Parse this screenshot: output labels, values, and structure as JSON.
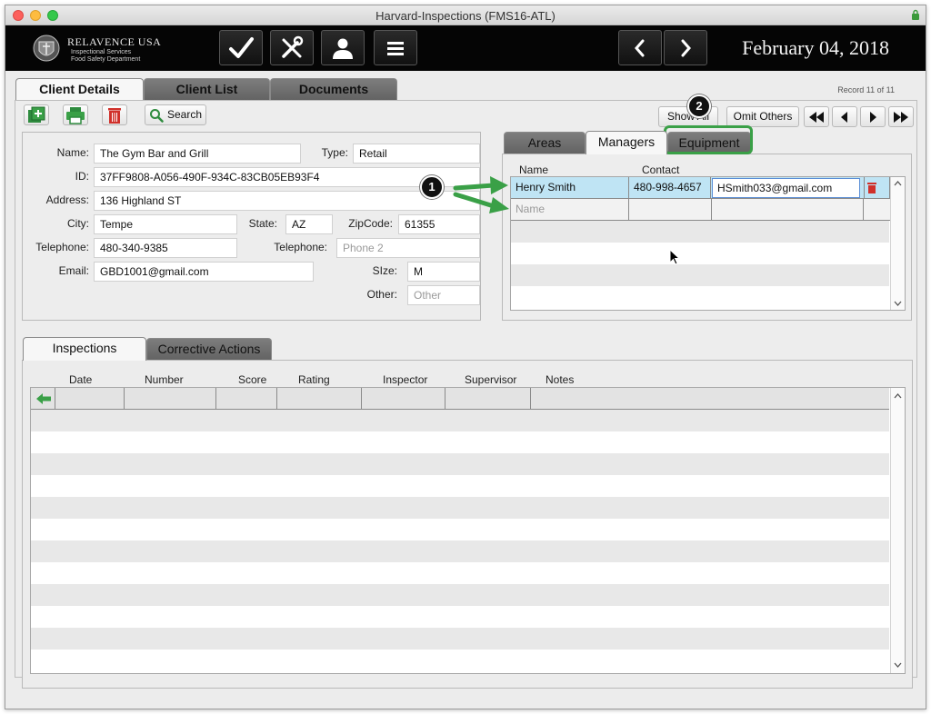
{
  "window": {
    "title": "Harvard-Inspections (FMS16-ATL)"
  },
  "toolbar": {
    "brand": "RELAVENCE USA",
    "brand_sub1": "Inspectional Services",
    "brand_sub2": "Food Safety Department",
    "date": "February 04, 2018",
    "buttons": [
      "checkmark-icon",
      "tools-icon",
      "person-icon",
      "menu-icon",
      "chevron-left-icon",
      "chevron-right-icon"
    ]
  },
  "tabs": {
    "client_details": "Client Details",
    "client_list": "Client List",
    "documents": "Documents"
  },
  "record_status": "Record 11 of 11",
  "actions": {
    "search": "Search",
    "show_all": "Show All",
    "omit_others": "Omit Others"
  },
  "client": {
    "name_label": "Name:",
    "name": "The Gym Bar and Grill",
    "type_label": "Type:",
    "type": "Retail",
    "id_label": "ID:",
    "id": "37FF9808-A056-490F-934C-83CB05EB93F4",
    "address_label": "Address:",
    "address": "136 Highland ST",
    "city_label": "City:",
    "city": "Tempe",
    "state_label": "State:",
    "state": "AZ",
    "zip_label": "ZipCode:",
    "zip": "61355",
    "telephone_label": "Telephone:",
    "telephone": "480-340-9385",
    "telephone2_label": "Telephone:",
    "telephone2_placeholder": "Phone 2",
    "email_label": "Email:",
    "email": "GBD1001@gmail.com",
    "size_label": "SIze:",
    "size": "M",
    "other_label": "Other:",
    "other_placeholder": "Other"
  },
  "sub_tabs": {
    "areas": "Areas",
    "managers": "Managers",
    "equipment": "Equipment"
  },
  "managers": {
    "col_name": "Name",
    "col_contact": "Contact",
    "rows": [
      {
        "name": "Henry Smith",
        "phone": "480-998-4657",
        "email": "HSmith033@gmail.com"
      }
    ],
    "new_row_placeholder": "Name"
  },
  "inspection_tabs": {
    "inspections": "Inspections",
    "corrective_actions": "Corrective Actions"
  },
  "inspections": {
    "columns": [
      "Date",
      "Number",
      "Score",
      "Rating",
      "Inspector",
      "Supervisor",
      "Notes"
    ]
  },
  "annotations": {
    "badge1": "1",
    "badge2": "2"
  },
  "colors": {
    "accent_green": "#3aa047",
    "highlight_row": "#bfe4f4",
    "delete_red": "#d0302a"
  }
}
